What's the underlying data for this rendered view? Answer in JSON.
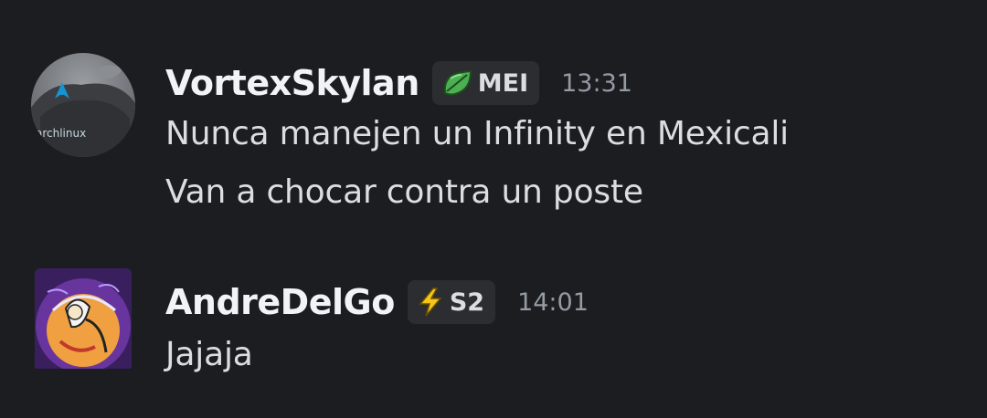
{
  "messages": [
    {
      "username": "VortexSkylan",
      "tag": {
        "icon": "leaf-icon",
        "text": "MEI",
        "color": "#4caf50"
      },
      "timestamp": "13:31",
      "avatar": {
        "icon": "archlinux-shirt-avatar",
        "logo_text": "archlinux"
      },
      "lines": [
        "Nunca manejen un Infinity en Mexicali",
        "Van a chocar contra un poste"
      ]
    },
    {
      "username": "AndreDelGo",
      "tag": {
        "icon": "lightning-icon",
        "text": "S2",
        "color": "#f5c518"
      },
      "timestamp": "14:01",
      "avatar": {
        "icon": "anime-art-avatar"
      },
      "lines": [
        "Jajaja"
      ]
    }
  ]
}
